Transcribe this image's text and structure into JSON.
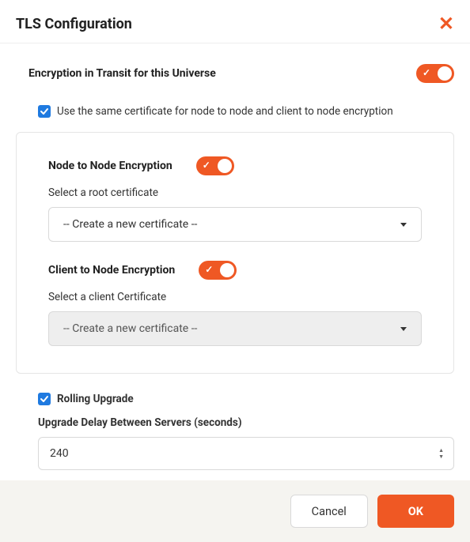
{
  "header": {
    "title": "TLS Configuration"
  },
  "encryption": {
    "label": "Encryption in Transit for this Universe",
    "enabled": true
  },
  "same_cert": {
    "label": "Use the same certificate for node to node and client to node encryption",
    "checked": true
  },
  "node_to_node": {
    "title": "Node to Node Encryption",
    "enabled": true,
    "select_label": "Select a root certificate",
    "select_value": "-- Create a new certificate --"
  },
  "client_to_node": {
    "title": "Client to Node Encryption",
    "enabled": true,
    "select_label": "Select a client Certificate",
    "select_value": "-- Create a new certificate --"
  },
  "rolling_upgrade": {
    "label": "Rolling Upgrade",
    "checked": true,
    "delay_label": "Upgrade Delay Between Servers (seconds)",
    "delay_value": "240"
  },
  "footer": {
    "cancel": "Cancel",
    "ok": "OK"
  }
}
